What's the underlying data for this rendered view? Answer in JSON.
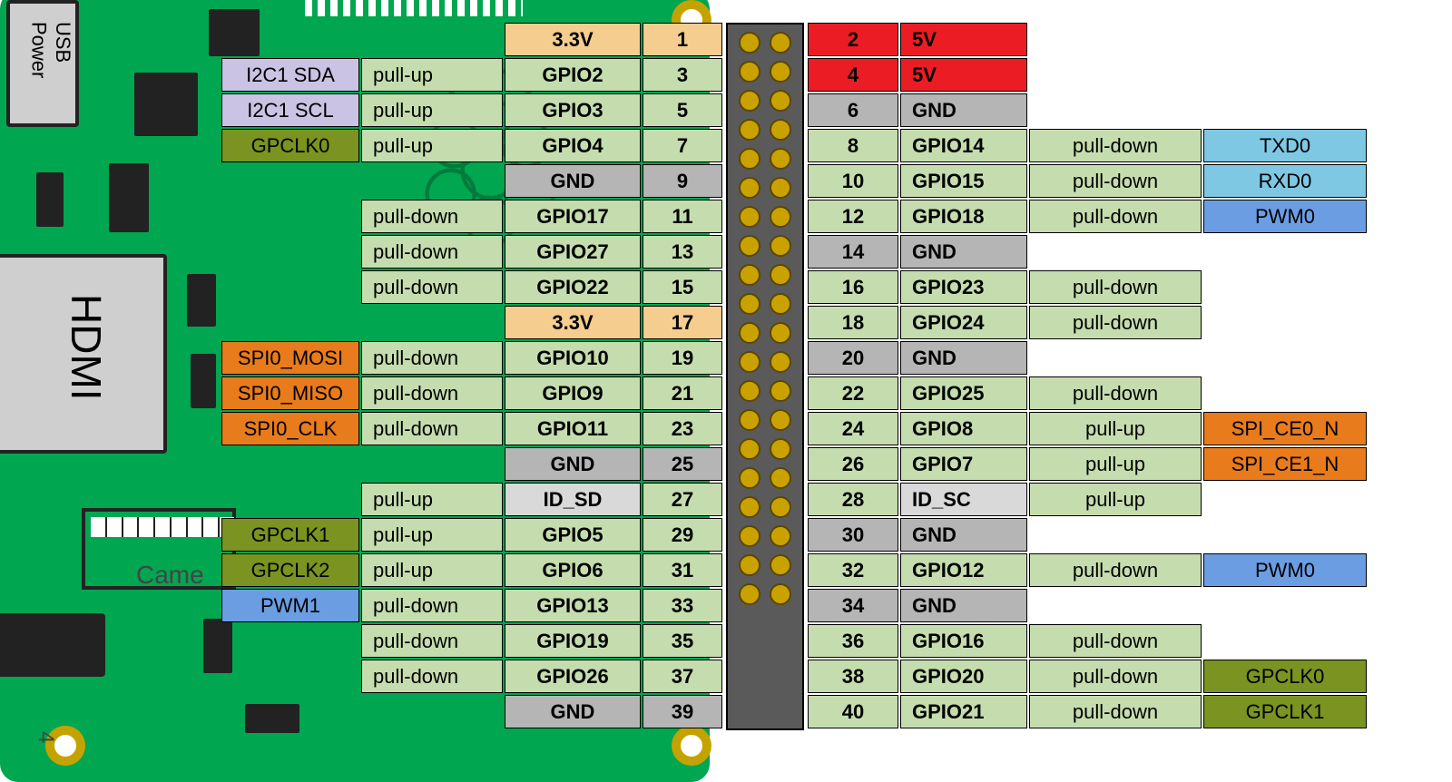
{
  "board": {
    "usb_power": "USB\nPower",
    "hdmi": "HDMI",
    "camera": "Came",
    "corner_num": "4"
  },
  "rows": [
    {
      "left": {
        "alt": null,
        "pull": null,
        "gpio": "3.3V",
        "gpioCls": "c-3v3",
        "num": "1",
        "numCls": "c-3v3"
      },
      "right": {
        "num": "2",
        "numCls": "c-5v",
        "gpio": "5V",
        "gpioCls": "c-5v",
        "pull": null,
        "alt": null
      }
    },
    {
      "left": {
        "alt": "I2C1 SDA",
        "altCls": "c-i2c",
        "pull": "pull-up",
        "gpio": "GPIO2",
        "num": "3"
      },
      "right": {
        "num": "4",
        "numCls": "c-5v",
        "gpio": "5V",
        "gpioCls": "c-5v"
      }
    },
    {
      "left": {
        "alt": "I2C1 SCL",
        "altCls": "c-i2c",
        "pull": "pull-up",
        "gpio": "GPIO3",
        "num": "5"
      },
      "right": {
        "num": "6",
        "numCls": "c-gnd",
        "gpio": "GND",
        "gpioCls": "c-gnd"
      }
    },
    {
      "left": {
        "alt": "GPCLK0",
        "altCls": "c-gpclk-l",
        "pull": "pull-up",
        "gpio": "GPIO4",
        "num": "7"
      },
      "right": {
        "num": "8",
        "gpio": "GPIO14",
        "pull": "pull-down",
        "alt": "TXD0",
        "altCls": "c-uart"
      }
    },
    {
      "left": {
        "gpio": "GND",
        "gpioCls": "c-gnd",
        "num": "9",
        "numCls": "c-gnd"
      },
      "right": {
        "num": "10",
        "gpio": "GPIO15",
        "pull": "pull-down",
        "alt": "RXD0",
        "altCls": "c-uart"
      }
    },
    {
      "left": {
        "pull": "pull-down",
        "gpio": "GPIO17",
        "num": "11"
      },
      "right": {
        "num": "12",
        "gpio": "GPIO18",
        "pull": "pull-down",
        "alt": "PWM0",
        "altCls": "c-pwm"
      }
    },
    {
      "left": {
        "pull": "pull-down",
        "gpio": "GPIO27",
        "num": "13"
      },
      "right": {
        "num": "14",
        "numCls": "c-gnd",
        "gpio": "GND",
        "gpioCls": "c-gnd"
      }
    },
    {
      "left": {
        "pull": "pull-down",
        "gpio": "GPIO22",
        "num": "15"
      },
      "right": {
        "num": "16",
        "gpio": "GPIO23",
        "pull": "pull-down"
      }
    },
    {
      "left": {
        "gpio": "3.3V",
        "gpioCls": "c-3v3",
        "num": "17",
        "numCls": "c-3v3"
      },
      "right": {
        "num": "18",
        "gpio": "GPIO24",
        "pull": "pull-down"
      }
    },
    {
      "left": {
        "alt": "SPI0_MOSI",
        "altCls": "c-spi",
        "pull": "pull-down",
        "gpio": "GPIO10",
        "num": "19"
      },
      "right": {
        "num": "20",
        "numCls": "c-gnd",
        "gpio": "GND",
        "gpioCls": "c-gnd"
      }
    },
    {
      "left": {
        "alt": "SPI0_MISO",
        "altCls": "c-spi",
        "pull": "pull-down",
        "gpio": "GPIO9",
        "num": "21"
      },
      "right": {
        "num": "22",
        "gpio": "GPIO25",
        "pull": "pull-down"
      }
    },
    {
      "left": {
        "alt": "SPI0_CLK",
        "altCls": "c-spi",
        "pull": "pull-down",
        "gpio": "GPIO11",
        "num": "23"
      },
      "right": {
        "num": "24",
        "gpio": "GPIO8",
        "pull": "pull-up",
        "alt": "SPI_CE0_N",
        "altCls": "c-spi"
      }
    },
    {
      "left": {
        "gpio": "GND",
        "gpioCls": "c-gnd",
        "num": "25",
        "numCls": "c-gnd"
      },
      "right": {
        "num": "26",
        "gpio": "GPIO7",
        "pull": "pull-up",
        "alt": "SPI_CE1_N",
        "altCls": "c-spi"
      }
    },
    {
      "left": {
        "pull": "pull-up",
        "gpio": "ID_SD",
        "gpioCls": "c-idsd",
        "num": "27"
      },
      "right": {
        "num": "28",
        "gpio": "ID_SC",
        "gpioCls": "c-idsd",
        "pull": "pull-up"
      }
    },
    {
      "left": {
        "alt": "GPCLK1",
        "altCls": "c-gpclk-l",
        "pull": "pull-up",
        "gpio": "GPIO5",
        "num": "29"
      },
      "right": {
        "num": "30",
        "numCls": "c-gnd",
        "gpio": "GND",
        "gpioCls": "c-gnd"
      }
    },
    {
      "left": {
        "alt": "GPCLK2",
        "altCls": "c-gpclk-l",
        "pull": "pull-up",
        "gpio": "GPIO6",
        "num": "31"
      },
      "right": {
        "num": "32",
        "gpio": "GPIO12",
        "pull": "pull-down",
        "alt": "PWM0",
        "altCls": "c-pwm"
      }
    },
    {
      "left": {
        "alt": "PWM1",
        "altCls": "c-pwm-l",
        "pull": "pull-down",
        "gpio": "GPIO13",
        "num": "33"
      },
      "right": {
        "num": "34",
        "numCls": "c-gnd",
        "gpio": "GND",
        "gpioCls": "c-gnd"
      }
    },
    {
      "left": {
        "pull": "pull-down",
        "gpio": "GPIO19",
        "num": "35"
      },
      "right": {
        "num": "36",
        "gpio": "GPIO16",
        "pull": "pull-down"
      }
    },
    {
      "left": {
        "pull": "pull-down",
        "gpio": "GPIO26",
        "num": "37"
      },
      "right": {
        "num": "38",
        "gpio": "GPIO20",
        "pull": "pull-down",
        "alt": "GPCLK0",
        "altCls": "c-gpclk-r"
      }
    },
    {
      "left": {
        "gpio": "GND",
        "gpioCls": "c-gnd",
        "num": "39",
        "numCls": "c-gnd"
      },
      "right": {
        "num": "40",
        "gpio": "GPIO21",
        "pull": "pull-down",
        "alt": "GPCLK1",
        "altCls": "c-gpclk-r"
      }
    }
  ]
}
